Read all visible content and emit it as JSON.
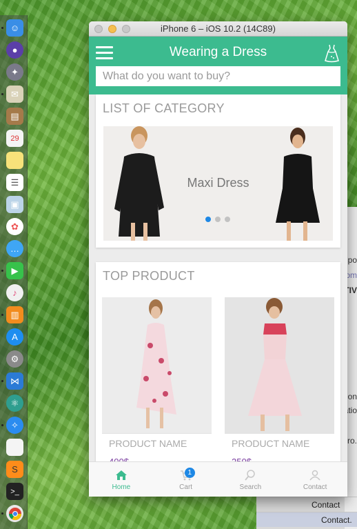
{
  "window": {
    "title": "iPhone 6 – iOS 10.2 (14C89)"
  },
  "app": {
    "title": "Wearing a Dress",
    "search_placeholder": "What do you want to buy?"
  },
  "category": {
    "heading": "LIST OF CATEGORY",
    "slide_label": "Maxi Dress",
    "pages": 3,
    "active_page": 1
  },
  "top_product": {
    "heading": "TOP PRODUCT",
    "items": [
      {
        "name": "PRODUCT NAME",
        "price": "400$"
      },
      {
        "name": "PRODUCT NAME",
        "price": "250$"
      }
    ]
  },
  "tabs": [
    {
      "label": "Home",
      "icon": "home-icon",
      "active": true
    },
    {
      "label": "Cart",
      "icon": "cart-icon",
      "badge": "1"
    },
    {
      "label": "Search",
      "icon": "search-icon"
    },
    {
      "label": "Contact",
      "icon": "user-icon"
    }
  ],
  "background_window": {
    "partial_text": [
      "po",
      "om",
      "TIV",
      "on",
      "atio",
      "ro."
    ],
    "rows": [
      "Contact",
      "Contact."
    ]
  },
  "colors": {
    "accent": "#3cbb8f",
    "badge": "#1e88e5",
    "price": "#7b3fa0"
  }
}
